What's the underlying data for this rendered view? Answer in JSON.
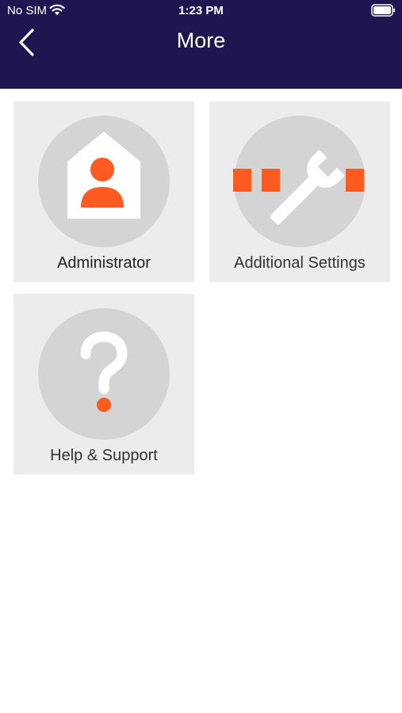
{
  "status_bar": {
    "carrier": "No SIM",
    "time": "1:23 PM",
    "wifi_icon": "wifi-icon",
    "battery_icon": "battery-icon"
  },
  "nav": {
    "title": "More",
    "back_icon": "chevron-left-icon"
  },
  "tiles": [
    {
      "label": "Administrator",
      "icon": "admin-house-icon"
    },
    {
      "label": "Additional Settings",
      "icon": "wrench-settings-icon"
    },
    {
      "label": "Help & Support",
      "icon": "question-mark-icon"
    }
  ],
  "colors": {
    "header_bg": "#1f1650",
    "accent": "#ff5a1f",
    "tile_bg": "#ececec",
    "circle_bg": "#d4d4d4"
  }
}
